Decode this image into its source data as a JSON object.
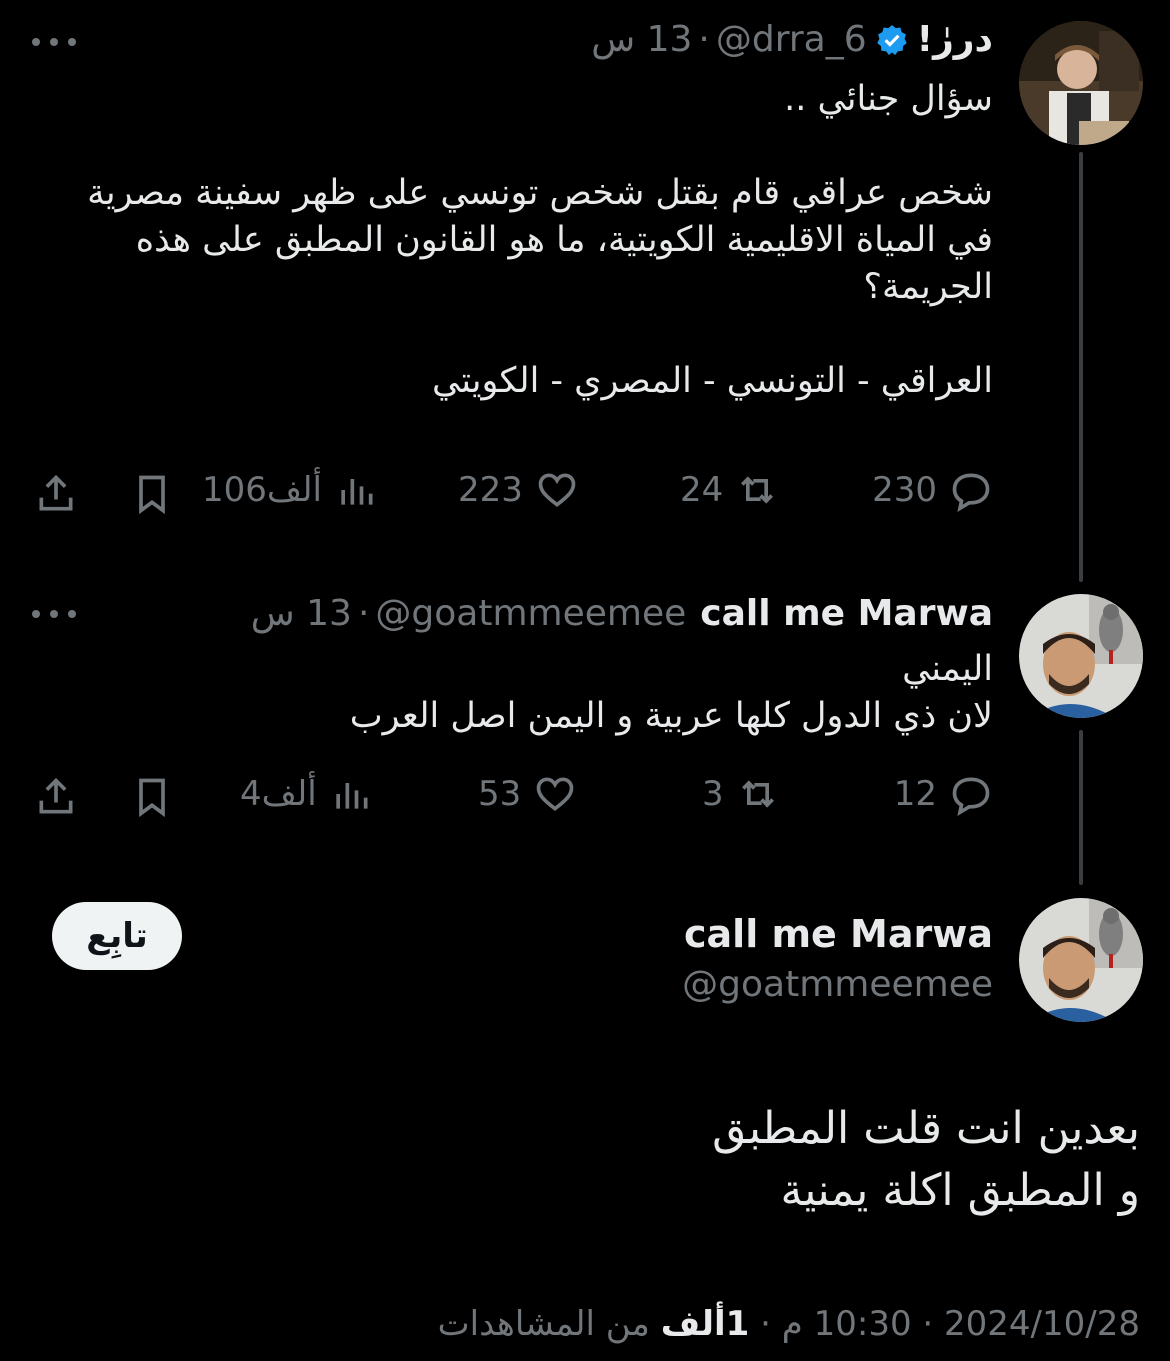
{
  "tweet1": {
    "display_name": "دررٰ!",
    "handle": "@drra_6",
    "time": "13 س",
    "text": "سؤال جنائي ..\n\nشخص عراقي قام بقتل شخص تونسي على ظهر سفينة مصرية في المياة الاقليمية الكويتية، ما هو القانون المطبق على هذه الجريمة؟\n\nالعراقي - التونسي - المصري - الكويتي",
    "replies": "230",
    "reposts": "24",
    "likes": "223",
    "views": "106ألف"
  },
  "tweet2": {
    "display_name": "call me Marwa",
    "handle": "@goatmmeemee",
    "time": "13 س",
    "text": "اليمني\nلان ذي الدول كلها عربية و اليمن اصل العرب",
    "replies": "12",
    "reposts": "3",
    "likes": "53",
    "views": "4ألف"
  },
  "main": {
    "display_name": "call me Marwa",
    "handle": "@goatmmeemee",
    "follow_label": "تابِع",
    "text": "بعدين انت قلت المطبق\nو المطبق اكلة يمنية",
    "date": "2024/10/28",
    "time": "10:30 م",
    "views_number": "1ألف",
    "views_suffix": "من المشاهدات"
  },
  "colors": {
    "background": "#000000",
    "text": "#e7e9ea",
    "muted": "#71767b",
    "verified": "#1d9bf0"
  },
  "icons": [
    "verified-badge-icon",
    "reply-icon",
    "repost-icon",
    "like-icon",
    "views-icon",
    "bookmark-icon",
    "share-icon",
    "more-icon"
  ]
}
